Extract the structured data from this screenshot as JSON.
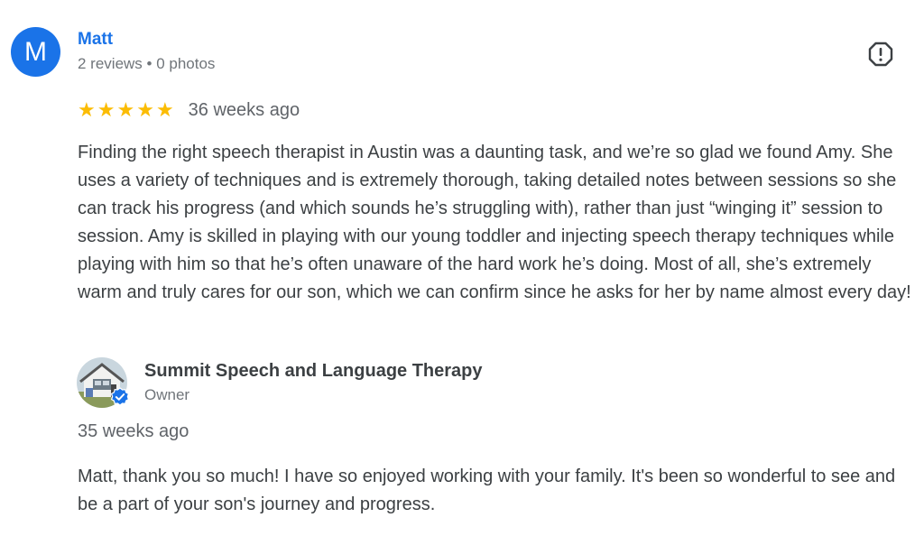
{
  "review": {
    "author": {
      "initial": "M",
      "name": "Matt",
      "meta": "2 reviews • 0 photos",
      "avatar_color": "#1a73e8"
    },
    "report_icon": "report-flag-icon",
    "rating": 5,
    "stars": [
      "★",
      "★",
      "★",
      "★",
      "★"
    ],
    "time": "36 weeks ago",
    "text": "Finding the right speech therapist in Austin was a daunting task, and we’re so glad we found Amy. She uses a variety of techniques and is extremely thorough, taking detailed notes between sessions so she can track his progress (and which sounds he’s struggling with), rather than just “winging it” session to session. Amy is skilled in playing with our young toddler and injecting speech therapy techniques while playing with him so that he’s often unaware of the hard work he’s doing. Most of all, she’s extremely warm and truly cares for our son, which we can confirm since he asks for her by name almost every day!"
  },
  "owner_response": {
    "name": "Summit Speech and Language Therapy",
    "role": "Owner",
    "time": "35 weeks ago",
    "text": "Matt, thank you so much! I have so enjoyed working with your family. It's been so wonderful to see and be a part of your son's journey and progress.",
    "verified_icon": "verified-check-icon"
  },
  "colors": {
    "accent": "#1a73e8",
    "star": "#fbbc04",
    "text": "#3c4043",
    "muted": "#70757a"
  }
}
